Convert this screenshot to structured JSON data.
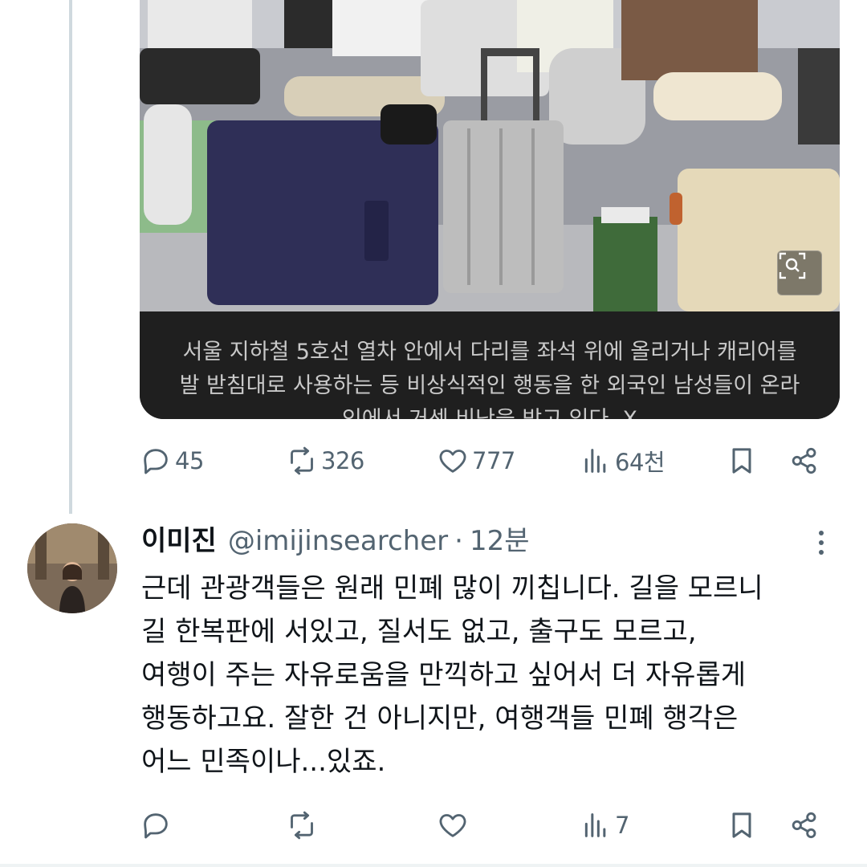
{
  "post": {
    "media_caption": "서울 지하철 5호선 열차 안에서 다리를 좌석 위에 올리거나 캐리어를\n발 받침대로 사용하는 등 비상식적인 행동을 한 외국인 남성들이 온라\n인에서 거센 비난을 받고 있다. X",
    "actions": {
      "replies": "45",
      "reposts": "326",
      "likes": "777",
      "views": "64천"
    }
  },
  "reply": {
    "name": "이미진",
    "handle": "@imijinsearcher",
    "separator": "·",
    "time": "12분",
    "text": "근데 관광객들은 원래 민폐 많이 끼칩니다. 길을 모르니\n길 한복판에 서있고, 질서도 없고, 출구도 모르고,\n여행이 주는 자유로움을 만끽하고 싶어서 더 자유롭게\n행동하고요. 잘한 건 아니지만, 여행객들 민폐 행각은\n어느 민족이나...있죠.",
    "actions": {
      "views": "7"
    }
  },
  "icons": {
    "reply": "reply-icon",
    "repost": "repost-icon",
    "like": "heart-icon",
    "views": "views-icon",
    "bookmark": "bookmark-icon",
    "share": "share-icon",
    "more": "more-icon",
    "zoom": "zoom-icon"
  },
  "colors": {
    "icon_gray": "#536471",
    "thread_line": "#cfd9de",
    "caption_bg": "#1f1f1f"
  }
}
